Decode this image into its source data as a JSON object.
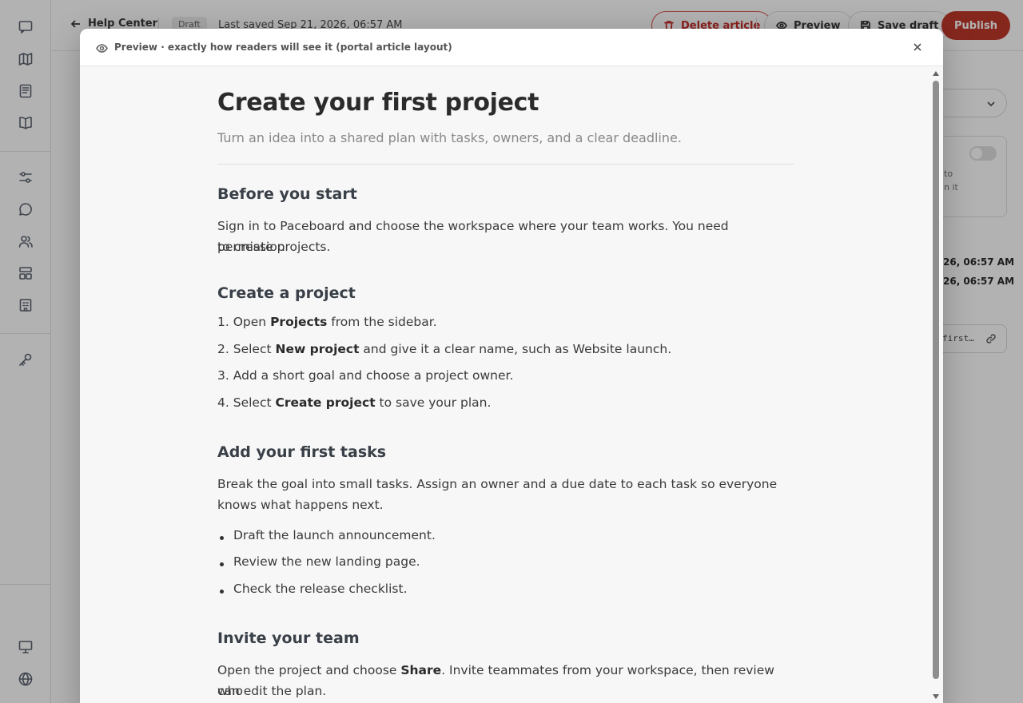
{
  "topbar": {
    "back_label": "Help Center",
    "status_badge": "Draft",
    "last_saved": "Last saved Sep 21, 2026, 06:57 AM",
    "delete_label": "Delete article",
    "preview_label": "Preview",
    "save_draft_label": "Save draft",
    "publish_label": "Publish"
  },
  "sidebar_right": {
    "card_text_1": "to",
    "card_text_2": "n it",
    "date_1": "26, 06:57 AM",
    "date_2": "26, 06:57 AM",
    "slug": "first…"
  },
  "modal": {
    "title": "Preview · exactly how readers will see it (portal article layout)"
  },
  "article": {
    "title": "Create your first project",
    "subtitle": "Turn an idea into a shared plan with tasks, owners, and a clear deadline.",
    "sec1_heading": "Before you start",
    "sec1_para_1": "Sign in to Paceboard and choose the workspace where your team works. You need permission",
    "sec1_para_2": "to create projects.",
    "sec2_heading": "Create a project",
    "steps": [
      {
        "num": "1.",
        "pre": "Open ",
        "bold": "Projects",
        "post": " from the sidebar."
      },
      {
        "num": "2.",
        "pre": "Select ",
        "bold": "New project",
        "post": " and give it a clear name, such as Website launch."
      },
      {
        "num": "3.",
        "pre": "Add a short goal and choose a project owner.",
        "bold": "",
        "post": ""
      },
      {
        "num": "4.",
        "pre": "Select ",
        "bold": "Create project",
        "post": " to save your plan."
      }
    ],
    "sec3_heading": "Add your first tasks",
    "sec3_para_1": "Break the goal into small tasks. Assign an owner and a due date to each task so everyone",
    "sec3_para_2": "knows what happens next.",
    "tasks": [
      "Draft the launch announcement.",
      "Review the new landing page.",
      "Check the release checklist."
    ],
    "sec4_heading": "Invite your team",
    "sec4_para_pre": "Open the project and choose ",
    "sec4_para_bold": "Share",
    "sec4_para_post": ". Invite teammates from your workspace, then review who",
    "sec4_para_2": "can edit the plan."
  }
}
